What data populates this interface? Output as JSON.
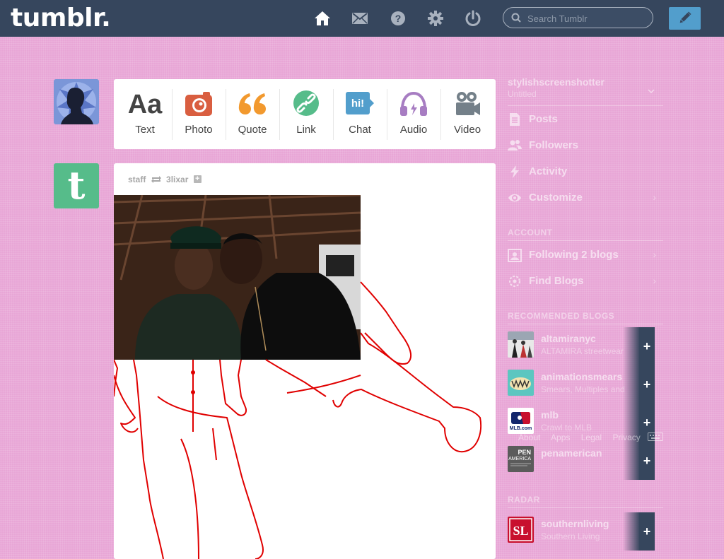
{
  "header": {
    "logo": "tumblr.",
    "search_placeholder": "Search Tumblr",
    "nav": [
      "home-icon",
      "mail-icon",
      "help-icon",
      "gear-icon",
      "power-icon"
    ]
  },
  "post_types": [
    {
      "label": "Text",
      "icon": "text-icon",
      "color": "#444444"
    },
    {
      "label": "Photo",
      "icon": "camera-icon",
      "color": "#d95e40"
    },
    {
      "label": "Quote",
      "icon": "quote-icon",
      "color": "#f2992e"
    },
    {
      "label": "Link",
      "icon": "link-icon",
      "color": "#56bc8a"
    },
    {
      "label": "Chat",
      "icon": "chat-icon",
      "color": "#529ecc"
    },
    {
      "label": "Audio",
      "icon": "headphones-icon",
      "color": "#a77dc2"
    },
    {
      "label": "Video",
      "icon": "video-camera-icon",
      "color": "#748089"
    }
  ],
  "post": {
    "author": "staff",
    "reblogged_from": "3lixar"
  },
  "sidebar": {
    "blog_name": "stylishscreenshotter",
    "blog_subtitle": "Untitled",
    "items": [
      {
        "label": "Posts",
        "icon": "posts-icon"
      },
      {
        "label": "Followers",
        "icon": "followers-icon"
      },
      {
        "label": "Activity",
        "icon": "activity-icon"
      },
      {
        "label": "Customize",
        "icon": "eye-icon"
      }
    ],
    "account_heading": "ACCOUNT",
    "account_items": [
      {
        "label": "Following 2 blogs",
        "icon": "following-icon"
      },
      {
        "label": "Find Blogs",
        "icon": "compass-icon"
      }
    ],
    "recommended_heading": "RECOMMENDED BLOGS",
    "recommended": [
      {
        "name": "altamiranyc",
        "desc": "ALTAMIRA streetwear"
      },
      {
        "name": "animationsmears",
        "desc": "Smears, Multiples and more"
      },
      {
        "name": "mlb",
        "desc": "Crawl to MLB"
      },
      {
        "name": "penamerican",
        "desc": ""
      }
    ],
    "footer_links": [
      "About",
      "Apps",
      "Legal",
      "Privacy"
    ],
    "radar_heading": "RADAR",
    "radar": {
      "name": "southernliving",
      "desc": "Southern Living"
    }
  },
  "colors": {
    "header_bg": "#36465d",
    "page_bg": "#e8a6d6",
    "accent": "#529ecc"
  }
}
